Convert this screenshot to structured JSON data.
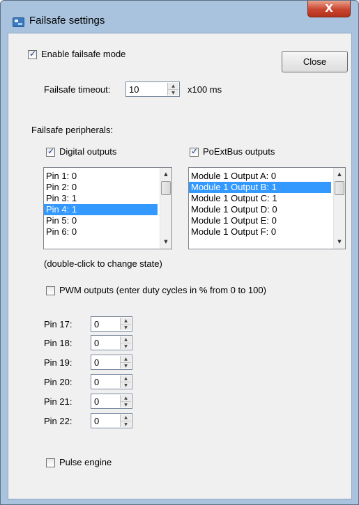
{
  "window": {
    "title": "Failsafe settings",
    "close_glyph": "X",
    "icon": "app-icon"
  },
  "enable_failsafe": {
    "label": "Enable failsafe mode",
    "checked": true
  },
  "close_button": {
    "label": "Close"
  },
  "timeout": {
    "label": "Failsafe timeout:",
    "value": "10",
    "unit": "x100 ms"
  },
  "peripherals_label": "Failsafe peripherals:",
  "digital_outputs": {
    "label": "Digital outputs",
    "checked": true,
    "items": [
      "Pin 1: 0",
      "Pin 2: 0",
      "Pin 3: 1",
      "Pin 4: 1",
      "Pin 5: 0",
      "Pin 6: 0"
    ],
    "selected_index": 3
  },
  "poextbus_outputs": {
    "label": "PoExtBus outputs",
    "checked": true,
    "items": [
      "Module 1 Output A: 0",
      "Module 1 Output B: 1",
      "Module 1 Output C: 1",
      "Module 1 Output D: 0",
      "Module 1 Output E: 0",
      "Module 1 Output F: 0"
    ],
    "selected_index": 1
  },
  "hint": "(double-click to change state)",
  "pwm": {
    "label": "PWM outputs (enter duty cycles in % from 0 to 100)",
    "checked": false,
    "pins": [
      {
        "label": "Pin 17:",
        "value": "0"
      },
      {
        "label": "Pin 18:",
        "value": "0"
      },
      {
        "label": "Pin 19:",
        "value": "0"
      },
      {
        "label": "Pin 20:",
        "value": "0"
      },
      {
        "label": "Pin 21:",
        "value": "0"
      },
      {
        "label": "Pin 22:",
        "value": "0"
      }
    ]
  },
  "pulse_engine": {
    "label": "Pulse engine",
    "checked": false
  },
  "colors": {
    "selection": "#3399ff",
    "window_frame": "#a9c3df",
    "close_button": "#c9452f",
    "client_bg": "#f0f0f0"
  }
}
